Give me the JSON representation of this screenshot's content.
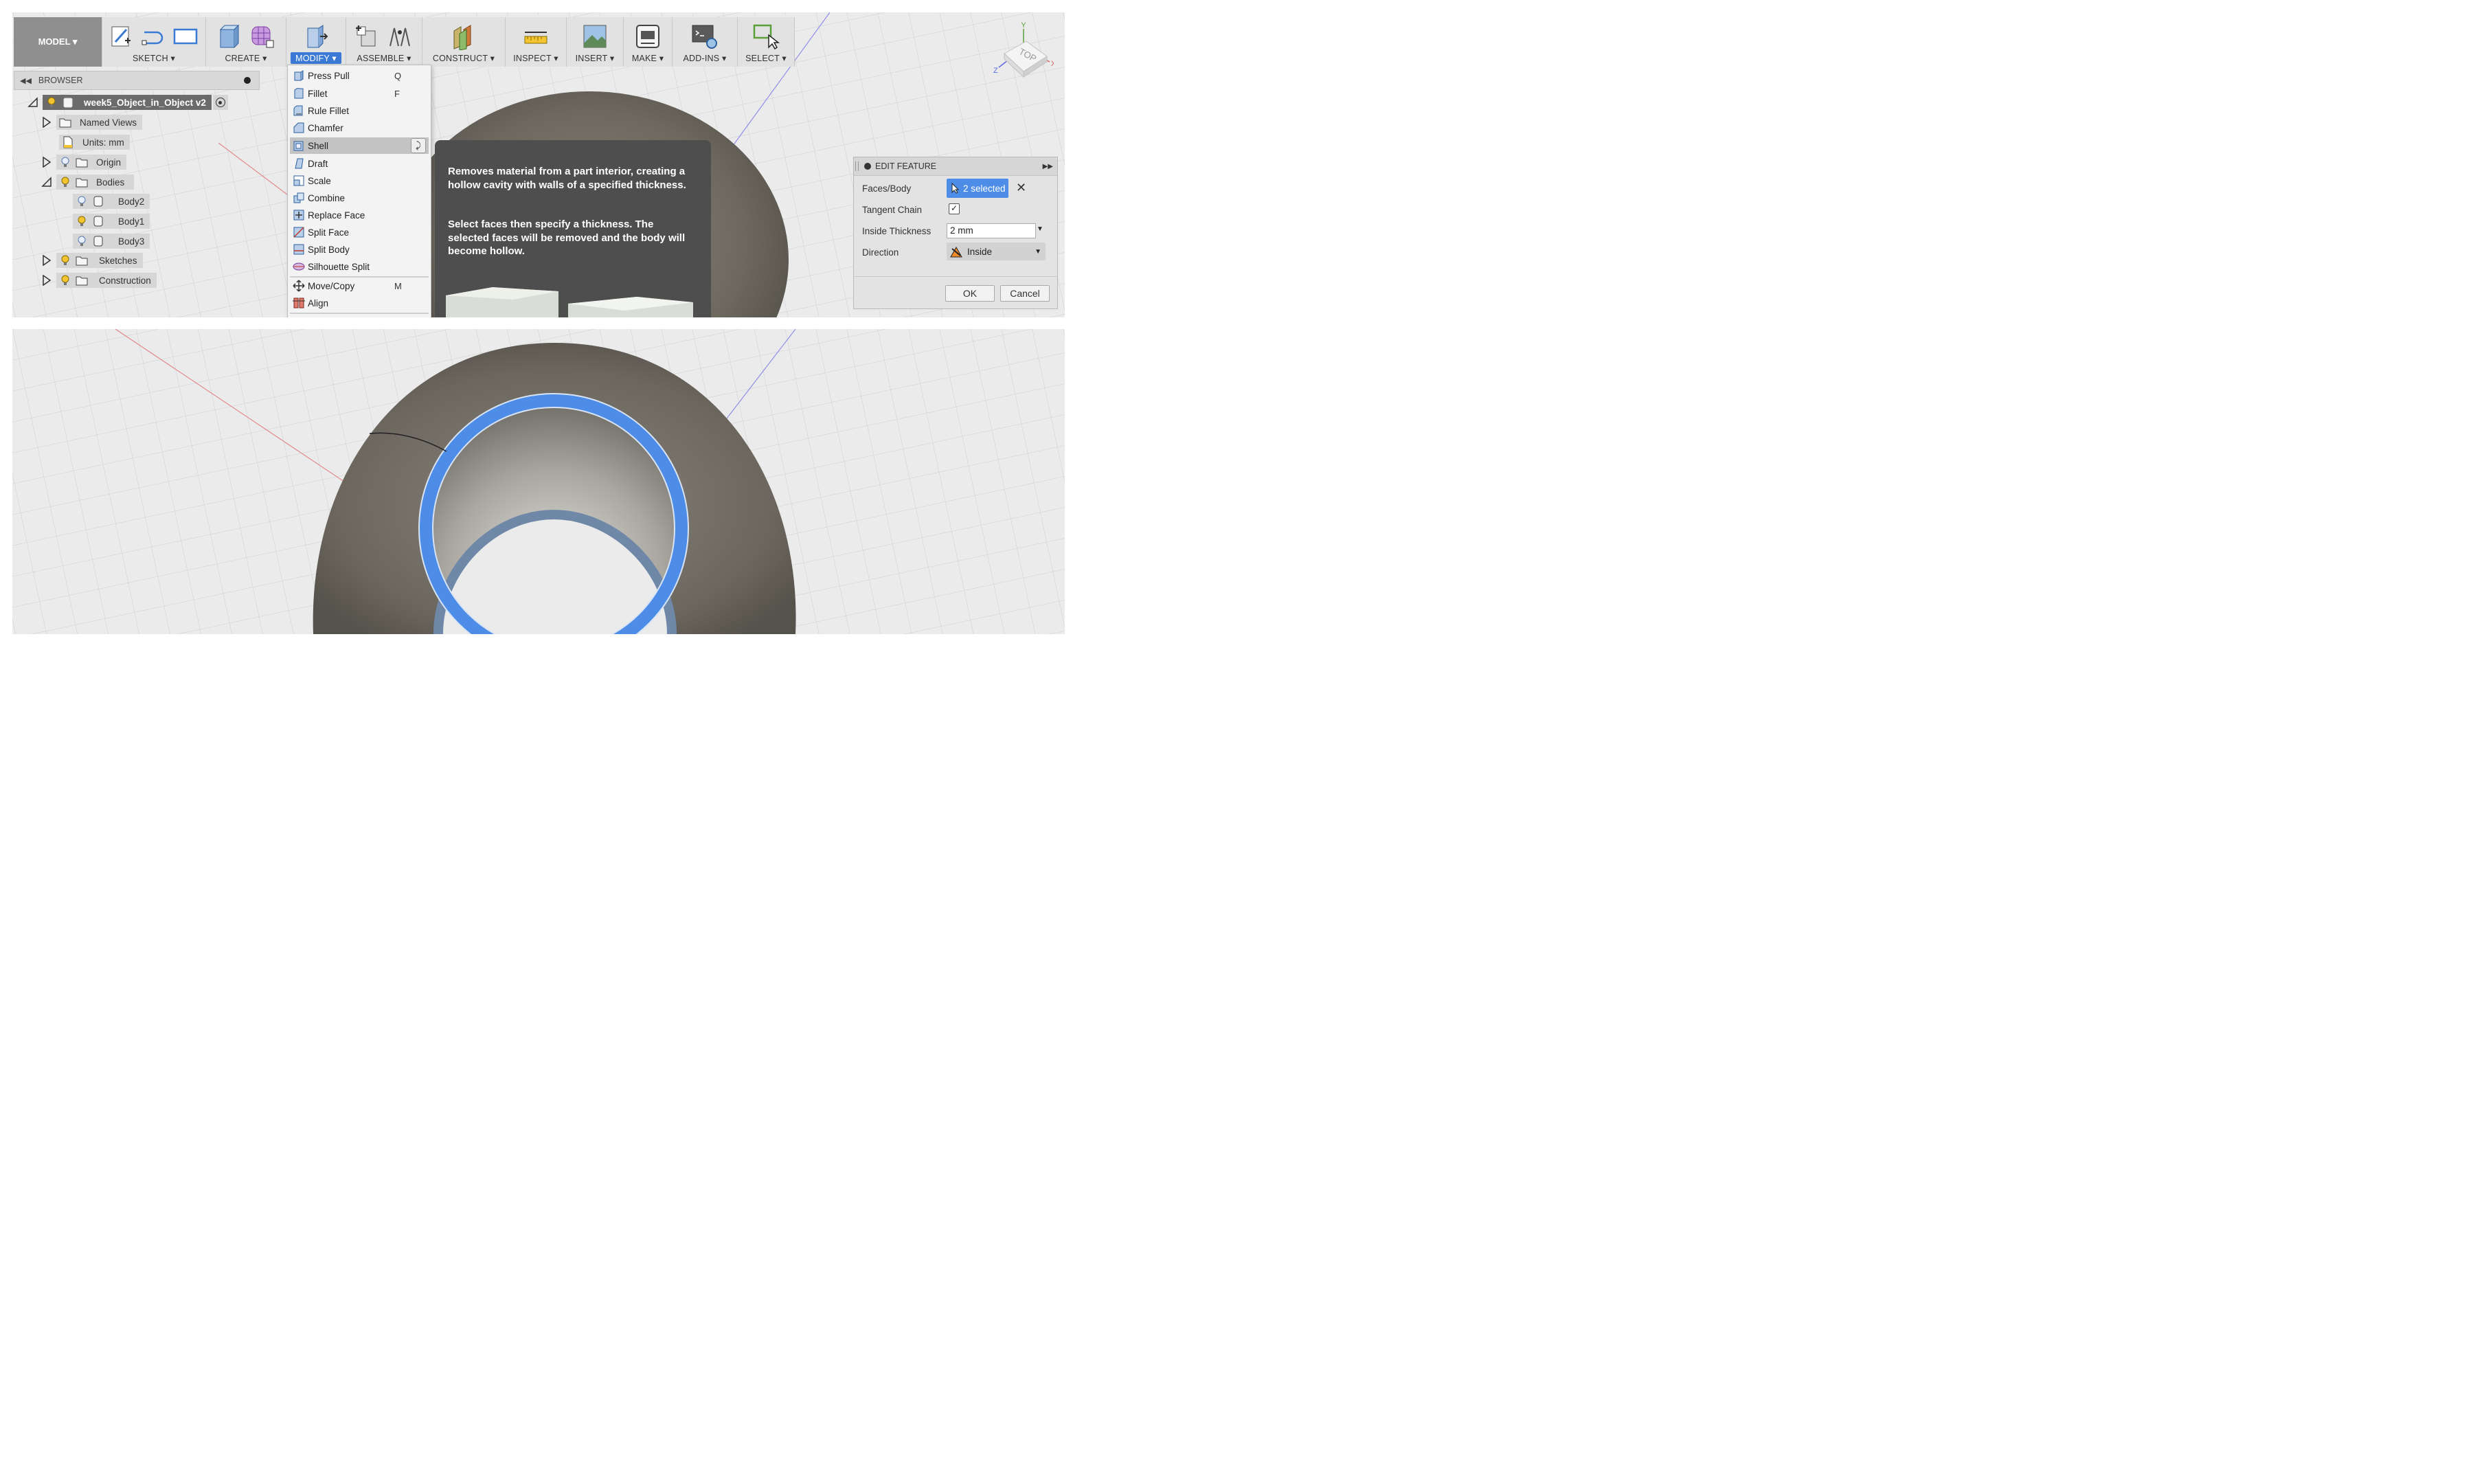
{
  "toolbar": {
    "model_label": "MODEL ▾",
    "groups": [
      {
        "label": "SKETCH ▾"
      },
      {
        "label": "CREATE ▾"
      },
      {
        "label": "MODIFY ▾"
      },
      {
        "label": "ASSEMBLE ▾"
      },
      {
        "label": "CONSTRUCT ▾"
      },
      {
        "label": "INSPECT ▾"
      },
      {
        "label": "INSERT ▾"
      },
      {
        "label": "MAKE ▾"
      },
      {
        "label": "ADD-INS ▾"
      },
      {
        "label": "SELECT ▾"
      }
    ],
    "active_color": "#3a79d4"
  },
  "browser": {
    "title": "BROWSER",
    "root": "week5_Object_in_Object v2",
    "items": [
      {
        "label": "Named Views"
      },
      {
        "label": "Units: mm"
      },
      {
        "label": "Origin"
      },
      {
        "label": "Bodies"
      },
      {
        "label": "Body2"
      },
      {
        "label": "Body1"
      },
      {
        "label": "Body3"
      },
      {
        "label": "Sketches"
      },
      {
        "label": "Construction"
      }
    ]
  },
  "modify_menu": {
    "items": [
      {
        "label": "Press Pull",
        "shortcut": "Q"
      },
      {
        "label": "Fillet",
        "shortcut": "F"
      },
      {
        "label": "Rule Fillet",
        "shortcut": ""
      },
      {
        "label": "Chamfer",
        "shortcut": ""
      },
      {
        "label": "Shell",
        "shortcut": ""
      },
      {
        "label": "Draft",
        "shortcut": ""
      },
      {
        "label": "Scale",
        "shortcut": ""
      },
      {
        "label": "Combine",
        "shortcut": ""
      },
      {
        "label": "Replace Face",
        "shortcut": ""
      },
      {
        "label": "Split Face",
        "shortcut": ""
      },
      {
        "label": "Split Body",
        "shortcut": ""
      },
      {
        "label": "Silhouette Split",
        "shortcut": ""
      },
      {
        "label": "Move/Copy",
        "shortcut": "M"
      },
      {
        "label": "Align",
        "shortcut": ""
      }
    ],
    "highlighted": "Shell"
  },
  "tooltip": {
    "line1": "Removes material from a part interior, creating a hollow cavity with walls of a specified thickness.",
    "line2": "Select faces then specify a thickness. The selected faces will be removed and the body will become hollow."
  },
  "edit_feature": {
    "title": "EDIT FEATURE",
    "faces_label": "Faces/Body",
    "faces_value": "2 selected",
    "tangent_label": "Tangent Chain",
    "tangent_checked": true,
    "thickness_label": "Inside Thickness",
    "thickness_value": "2 mm",
    "direction_label": "Direction",
    "direction_value": "Inside",
    "ok": "OK",
    "cancel": "Cancel"
  },
  "viewcube": {
    "face": "TOP",
    "axis_x": "X",
    "axis_y": "Y",
    "axis_z": "Z"
  },
  "colors": {
    "selection_blue": "#4d8de8",
    "menu_highlight": "#c3c3c3",
    "tooltip_bg": "#4e4e4e"
  }
}
